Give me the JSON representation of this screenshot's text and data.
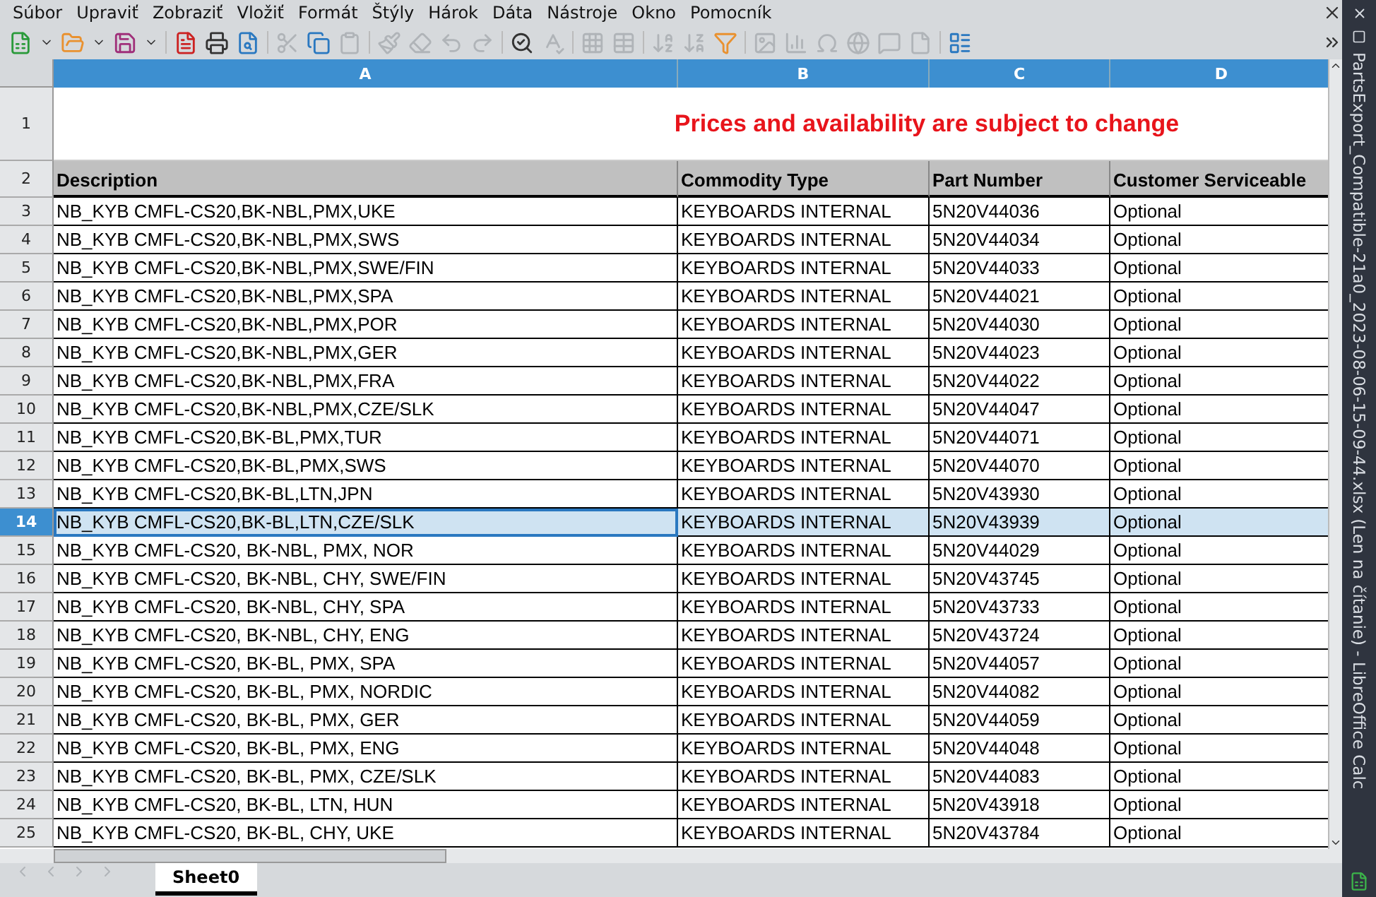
{
  "window": {
    "title": "PartsExport_Compatible-21a0_2023-08-06-15-09-44.xlsx (Len na čítanie) - LibreOffice Calc"
  },
  "menu": [
    "Súbor",
    "Upraviť",
    "Zobraziť",
    "Vložiť",
    "Formát",
    "Štýly",
    "Hárok",
    "Dáta",
    "Nástroje",
    "Okno",
    "Pomocník"
  ],
  "columns": [
    "A",
    "B",
    "C",
    "D"
  ],
  "notice_row": {
    "number": "1",
    "text": "Prices and availability are subject to change"
  },
  "header_row": {
    "number": "2",
    "cells": [
      "Description",
      "Commodity Type",
      "Part Number",
      "Customer Serviceable"
    ]
  },
  "rows": [
    {
      "number": "3",
      "selected": false,
      "cells": [
        "NB_KYB CMFL-CS20,BK-NBL,PMX,UKE",
        "KEYBOARDS INTERNAL",
        "5N20V44036",
        "Optional"
      ]
    },
    {
      "number": "4",
      "selected": false,
      "cells": [
        "NB_KYB CMFL-CS20,BK-NBL,PMX,SWS",
        "KEYBOARDS INTERNAL",
        "5N20V44034",
        "Optional"
      ]
    },
    {
      "number": "5",
      "selected": false,
      "cells": [
        "NB_KYB CMFL-CS20,BK-NBL,PMX,SWE/FIN",
        "KEYBOARDS INTERNAL",
        "5N20V44033",
        "Optional"
      ]
    },
    {
      "number": "6",
      "selected": false,
      "cells": [
        "NB_KYB CMFL-CS20,BK-NBL,PMX,SPA",
        "KEYBOARDS INTERNAL",
        "5N20V44021",
        "Optional"
      ]
    },
    {
      "number": "7",
      "selected": false,
      "cells": [
        "NB_KYB CMFL-CS20,BK-NBL,PMX,POR",
        "KEYBOARDS INTERNAL",
        "5N20V44030",
        "Optional"
      ]
    },
    {
      "number": "8",
      "selected": false,
      "cells": [
        "NB_KYB CMFL-CS20,BK-NBL,PMX,GER",
        "KEYBOARDS INTERNAL",
        "5N20V44023",
        "Optional"
      ]
    },
    {
      "number": "9",
      "selected": false,
      "cells": [
        "NB_KYB CMFL-CS20,BK-NBL,PMX,FRA",
        "KEYBOARDS INTERNAL",
        "5N20V44022",
        "Optional"
      ]
    },
    {
      "number": "10",
      "selected": false,
      "cells": [
        "NB_KYB CMFL-CS20,BK-NBL,PMX,CZE/SLK",
        "KEYBOARDS INTERNAL",
        "5N20V44047",
        "Optional"
      ]
    },
    {
      "number": "11",
      "selected": false,
      "cells": [
        "NB_KYB CMFL-CS20,BK-BL,PMX,TUR",
        "KEYBOARDS INTERNAL",
        "5N20V44071",
        "Optional"
      ]
    },
    {
      "number": "12",
      "selected": false,
      "cells": [
        "NB_KYB CMFL-CS20,BK-BL,PMX,SWS",
        "KEYBOARDS INTERNAL",
        "5N20V44070",
        "Optional"
      ]
    },
    {
      "number": "13",
      "selected": false,
      "cells": [
        "NB_KYB CMFL-CS20,BK-BL,LTN,JPN",
        "KEYBOARDS INTERNAL",
        "5N20V43930",
        "Optional"
      ]
    },
    {
      "number": "14",
      "selected": true,
      "cells": [
        "NB_KYB CMFL-CS20,BK-BL,LTN,CZE/SLK",
        "KEYBOARDS INTERNAL",
        "5N20V43939",
        "Optional"
      ]
    },
    {
      "number": "15",
      "selected": false,
      "cells": [
        "NB_KYB CMFL-CS20, BK-NBL, PMX, NOR",
        "KEYBOARDS INTERNAL",
        "5N20V44029",
        "Optional"
      ]
    },
    {
      "number": "16",
      "selected": false,
      "cells": [
        "NB_KYB CMFL-CS20, BK-NBL, CHY, SWE/FIN",
        "KEYBOARDS INTERNAL",
        "5N20V43745",
        "Optional"
      ]
    },
    {
      "number": "17",
      "selected": false,
      "cells": [
        "NB_KYB CMFL-CS20, BK-NBL, CHY, SPA",
        "KEYBOARDS INTERNAL",
        "5N20V43733",
        "Optional"
      ]
    },
    {
      "number": "18",
      "selected": false,
      "cells": [
        "NB_KYB CMFL-CS20, BK-NBL, CHY, ENG",
        "KEYBOARDS INTERNAL",
        "5N20V43724",
        "Optional"
      ]
    },
    {
      "number": "19",
      "selected": false,
      "cells": [
        "NB_KYB CMFL-CS20, BK-BL, PMX, SPA",
        "KEYBOARDS INTERNAL",
        "5N20V44057",
        "Optional"
      ]
    },
    {
      "number": "20",
      "selected": false,
      "cells": [
        "NB_KYB CMFL-CS20, BK-BL, PMX, NORDIC",
        "KEYBOARDS INTERNAL",
        "5N20V44082",
        "Optional"
      ]
    },
    {
      "number": "21",
      "selected": false,
      "cells": [
        "NB_KYB CMFL-CS20, BK-BL, PMX, GER",
        "KEYBOARDS INTERNAL",
        "5N20V44059",
        "Optional"
      ]
    },
    {
      "number": "22",
      "selected": false,
      "cells": [
        "NB_KYB CMFL-CS20, BK-BL, PMX, ENG",
        "KEYBOARDS INTERNAL",
        "5N20V44048",
        "Optional"
      ]
    },
    {
      "number": "23",
      "selected": false,
      "cells": [
        "NB_KYB CMFL-CS20, BK-BL, PMX, CZE/SLK",
        "KEYBOARDS INTERNAL",
        "5N20V44083",
        "Optional"
      ]
    },
    {
      "number": "24",
      "selected": false,
      "cells": [
        "NB_KYB CMFL-CS20, BK-BL, LTN, HUN",
        "KEYBOARDS INTERNAL",
        "5N20V43918",
        "Optional"
      ]
    },
    {
      "number": "25",
      "selected": false,
      "cells": [
        "NB_KYB CMFL-CS20, BK-BL, CHY, UKE",
        "KEYBOARDS INTERNAL",
        "5N20V43784",
        "Optional"
      ]
    }
  ],
  "sheet_tabs": [
    {
      "label": "Sheet0",
      "selected": true
    }
  ]
}
